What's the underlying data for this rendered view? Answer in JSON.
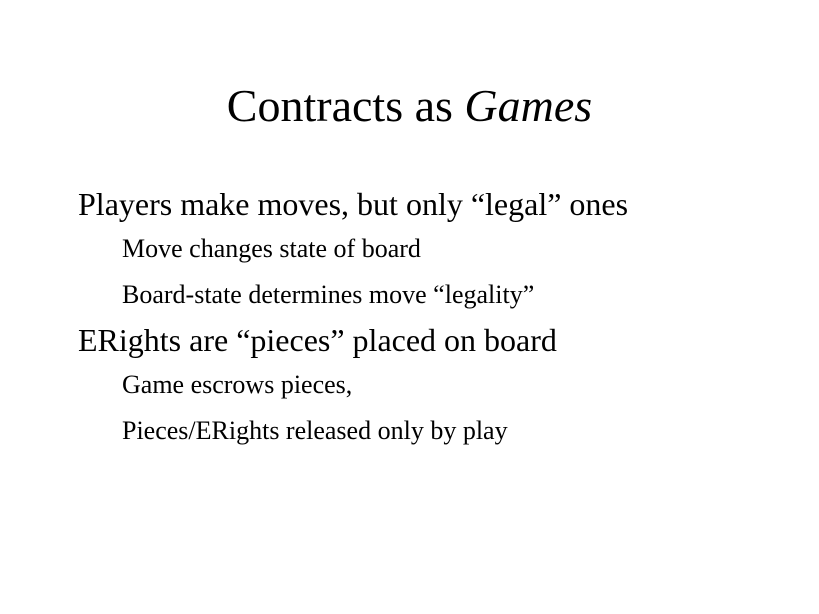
{
  "slide": {
    "title_prefix": "Contracts as ",
    "title_emphasis": "Games",
    "bullets": [
      {
        "text": "Players make moves, but only “legal” ones",
        "sub": [
          "Move changes state of board",
          "Board-state determines move “legality”"
        ]
      },
      {
        "text": "ERights are “pieces” placed on board",
        "sub": [
          "Game escrows pieces,",
          "Pieces/ERights released only by play"
        ]
      }
    ]
  }
}
